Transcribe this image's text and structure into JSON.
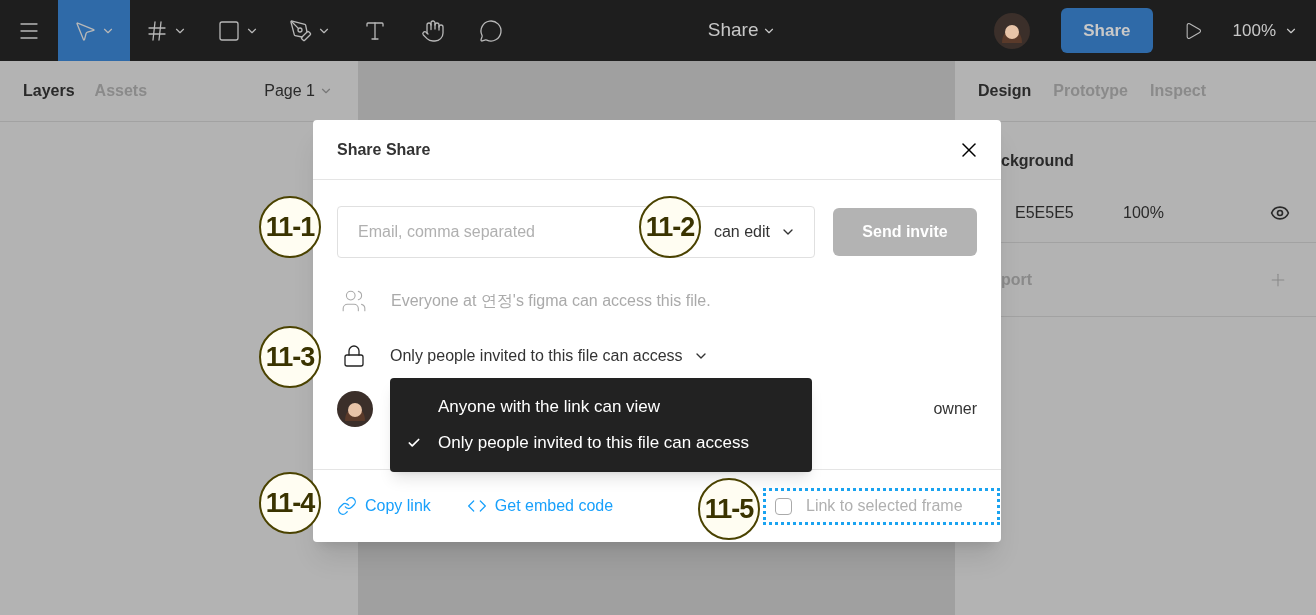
{
  "toolbar": {
    "tools": [
      {
        "kind": "menu",
        "selected": false,
        "dropdown": false
      },
      {
        "kind": "move",
        "selected": true,
        "dropdown": true
      },
      {
        "kind": "frame",
        "selected": false,
        "dropdown": true
      },
      {
        "kind": "shape",
        "selected": false,
        "dropdown": true
      },
      {
        "kind": "pen",
        "selected": false,
        "dropdown": true
      },
      {
        "kind": "text",
        "selected": false,
        "dropdown": false
      },
      {
        "kind": "hand",
        "selected": false,
        "dropdown": false
      },
      {
        "kind": "comment",
        "selected": false,
        "dropdown": false
      }
    ],
    "file_title": "Share",
    "share_button": "Share",
    "zoom": "100%"
  },
  "left_panel": {
    "tabs": [
      {
        "label": "Layers",
        "selected": true
      },
      {
        "label": "Assets",
        "selected": false
      }
    ],
    "page": "Page 1"
  },
  "right_panel": {
    "tabs": [
      {
        "label": "Design",
        "selected": true
      },
      {
        "label": "Prototype",
        "selected": false
      },
      {
        "label": "Inspect",
        "selected": false
      }
    ],
    "section_title": "ckground",
    "fill_hex": "E5E5E5",
    "fill_opacity": "100%",
    "export_title": "port"
  },
  "dialog": {
    "title": "Share Share",
    "email_placeholder": "Email, comma separated",
    "permission": "can edit",
    "send_button": {
      "label": "Send invite",
      "disabled": true
    },
    "team_note": "Everyone at 연정's figma can access this file.",
    "access": "Only people invited to this file can access",
    "access_menu": [
      {
        "label": "Anyone with the link can view",
        "selected": false
      },
      {
        "label": "Only people invited to this file can access",
        "selected": true
      }
    ],
    "member_role": "owner",
    "copy_link": "Copy link",
    "embed_code": "Get embed code",
    "link_frame": {
      "label": "Link to selected frame",
      "checked": false
    }
  },
  "annotations": [
    "11-1",
    "11-2",
    "11-3",
    "11-4",
    "11-5"
  ]
}
